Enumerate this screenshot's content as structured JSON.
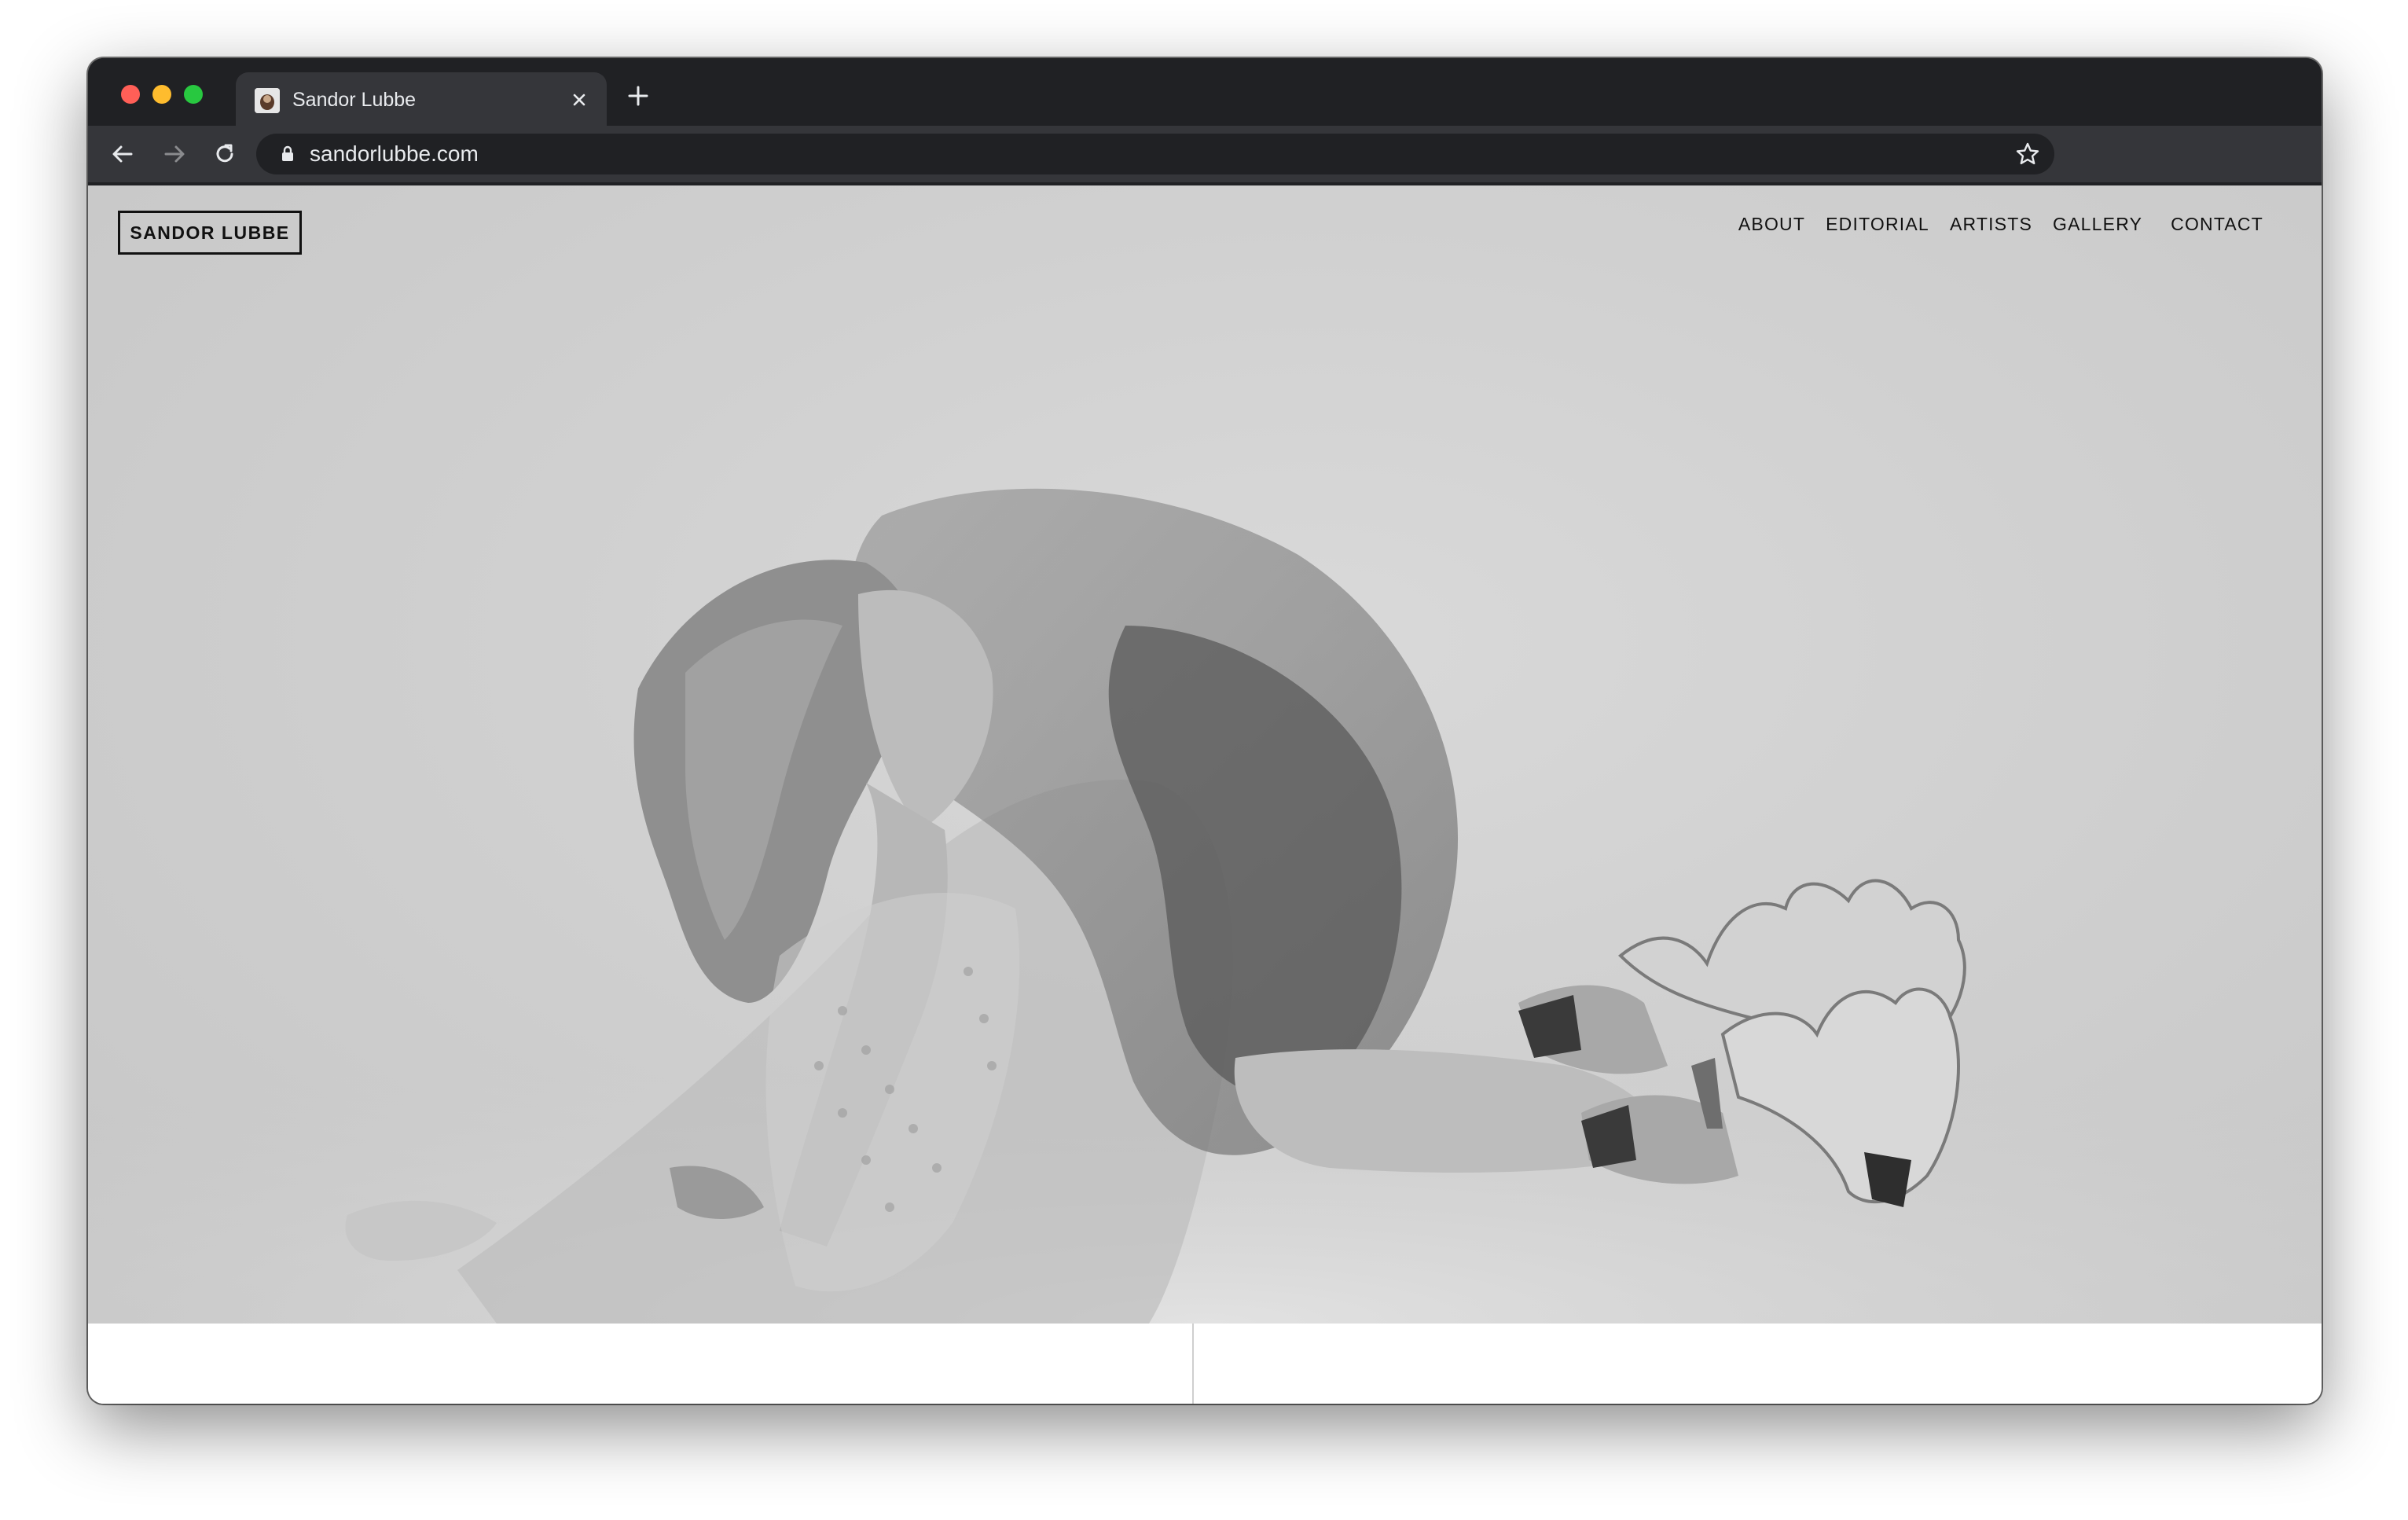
{
  "browser": {
    "tab": {
      "title": "Sandor Lubbe",
      "favicon": "portrait-favicon"
    },
    "new_tab_icon": "plus-icon",
    "close_icon": "close-icon",
    "address": {
      "url": "sandorlubbe.com"
    },
    "icons": {
      "back": "arrow-left-icon",
      "forward": "arrow-right-icon",
      "reload": "reload-icon",
      "lock": "lock-icon",
      "bookmark": "star-icon"
    }
  },
  "site": {
    "logo": "SANDOR LUBBE",
    "nav": [
      "ABOUT",
      "EDITORIAL",
      "ARTISTS",
      "GALLERY",
      "CONTACT"
    ],
    "hero_image": "black-and-white photo of a kneeling woman in a sheer tulle dress wearing flame-shaped platform heels"
  },
  "colors": {
    "chrome_dark": "#202124",
    "chrome_toolbar": "#35363a",
    "hero_bg": "#d0d0d0",
    "text": "#111111"
  }
}
